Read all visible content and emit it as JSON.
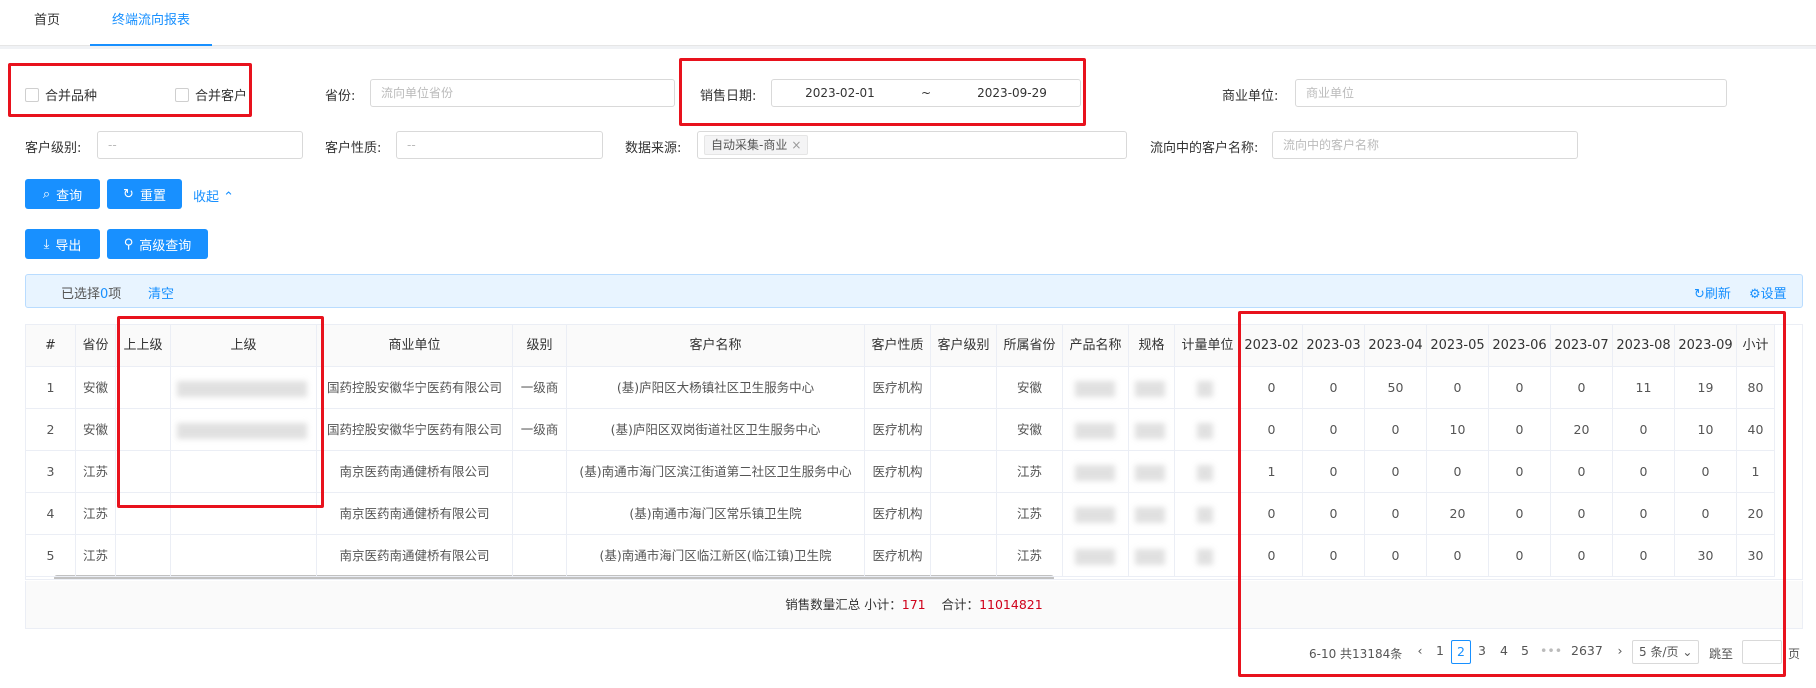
{
  "tabs": [
    {
      "label": "首页"
    },
    {
      "label": "终端流向报表"
    }
  ],
  "filters": {
    "merge_variety": "合并品种",
    "merge_customer": "合并客户",
    "province_label": "省份:",
    "province_placeholder": "流向单位省份",
    "sale_date_label": "销售日期:",
    "date_start": "2023-02-01",
    "date_sep": "~",
    "date_end": "2023-09-29",
    "business_unit_label": "商业单位:",
    "business_unit_placeholder": "商业单位",
    "customer_level_label": "客户级别:",
    "customer_level_value": "--",
    "customer_nature_label": "客户性质:",
    "customer_nature_value": "--",
    "data_source_label": "数据来源:",
    "data_source_tag": "自动采集-商业",
    "flow_customer_label": "流向中的客户名称:",
    "flow_customer_placeholder": "流向中的客户名称"
  },
  "buttons": {
    "query": "查询",
    "reset": "重置",
    "collapse": "收起",
    "export": "导出",
    "advanced": "高级查询"
  },
  "alert": {
    "selected_prefix": "已选择",
    "selected_count": "0",
    "selected_suffix": "项",
    "clear": "清空",
    "refresh": "刷新",
    "settings": "设置"
  },
  "table": {
    "headers": [
      "#",
      "省份",
      "上上级",
      "上级",
      "商业单位",
      "级别",
      "客户名称",
      "客户性质",
      "客户级别",
      "所属省份",
      "产品名称",
      "规格",
      "计量单位",
      "2023-02",
      "2023-03",
      "2023-04",
      "2023-05",
      "2023-06",
      "2023-07",
      "2023-08",
      "2023-09",
      "小计"
    ],
    "rows": [
      [
        "1",
        "安徽",
        "",
        "",
        "国药控股安徽华宁医药有限公司",
        "一级商",
        "(基)庐阳区大杨镇社区卫生服务中心",
        "医疗机构",
        "",
        "安徽",
        "",
        "",
        "",
        "0",
        "0",
        "50",
        "0",
        "0",
        "0",
        "11",
        "19",
        "80"
      ],
      [
        "2",
        "安徽",
        "",
        "",
        "国药控股安徽华宁医药有限公司",
        "一级商",
        "(基)庐阳区双岗街道社区卫生服务中心",
        "医疗机构",
        "",
        "安徽",
        "",
        "",
        "",
        "0",
        "0",
        "0",
        "10",
        "0",
        "20",
        "0",
        "10",
        "40"
      ],
      [
        "3",
        "江苏",
        "",
        "",
        "南京医药南通健桥有限公司",
        "",
        "(基)南通市海门区滨江街道第二社区卫生服务中心",
        "医疗机构",
        "",
        "江苏",
        "",
        "",
        "",
        "1",
        "0",
        "0",
        "0",
        "0",
        "0",
        "0",
        "0",
        "1"
      ],
      [
        "4",
        "江苏",
        "",
        "",
        "南京医药南通健桥有限公司",
        "",
        "(基)南通市海门区常乐镇卫生院",
        "医疗机构",
        "",
        "江苏",
        "",
        "",
        "",
        "0",
        "0",
        "0",
        "20",
        "0",
        "0",
        "0",
        "0",
        "20"
      ],
      [
        "5",
        "江苏",
        "",
        "",
        "南京医药南通健桥有限公司",
        "",
        "(基)南通市海门区临江新区(临江镇)卫生院",
        "医疗机构",
        "",
        "江苏",
        "",
        "",
        "",
        "0",
        "0",
        "0",
        "0",
        "0",
        "0",
        "0",
        "30",
        "30"
      ]
    ]
  },
  "summary": {
    "label": "销售数量汇总 小计：",
    "subtotal": "171",
    "total_label": "合计：",
    "total": "11014821"
  },
  "pagination": {
    "range": "6-10 共13184条",
    "pages": [
      "1",
      "2",
      "3",
      "4",
      "5"
    ],
    "ellipsis": "•••",
    "last": "2637",
    "page_size": "5 条/页",
    "jump_label": "跳至",
    "page_unit": "页"
  }
}
